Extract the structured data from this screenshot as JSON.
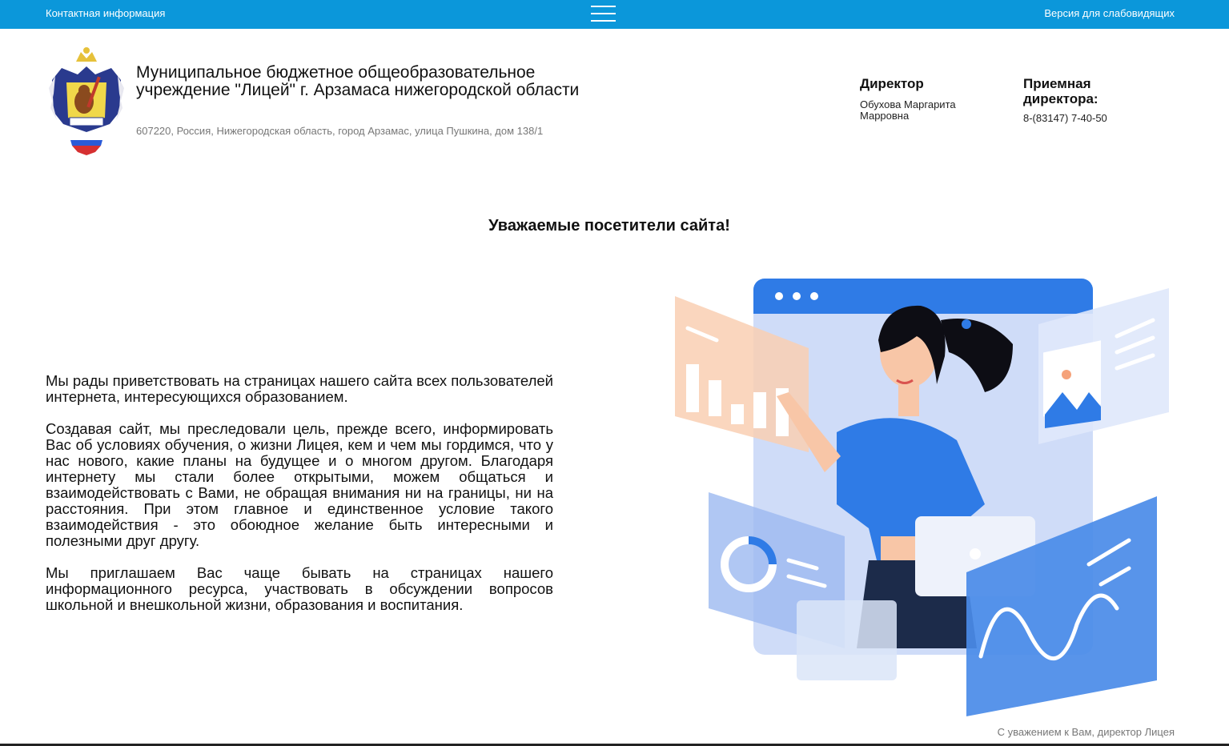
{
  "topbar": {
    "contact_link": "Контактная информация",
    "menu_icon": "hamburger-menu-icon",
    "accessibility_link": "Версия для слабовидящих",
    "background_color": "#0b97da"
  },
  "header": {
    "logo_icon": "school-emblem-logo",
    "org_name": "Муниципальное бюджетное общеобразовательное учреждение \"Лицей\" г. Арзамаса нижегородской области",
    "address": "607220, Россия, Нижегородская область, город Арзамас, улица Пушкина, дом 138/1",
    "director": {
      "title": "Директор",
      "name": "Обухова Маргарита Марровна"
    },
    "reception": {
      "title": "Приемная директора:",
      "phone": "8-(83147) 7-40-50"
    }
  },
  "main": {
    "greeting": "Уважаемые посетители сайта!",
    "paragraphs": [
      "Мы рады приветствовать на страницах нашего сайта всех пользователей интернета, интересующихся образованием.",
      "Создавая сайт, мы преследовали цель, прежде всего, информировать Вас об условиях обучения, о жизни Лицея, кем и чем мы гордимся, что у нас нового, какие планы на будущее и о многом другом. Благодаря интернету мы стали более открытыми, можем общаться и взаимодействовать с Вами, не обращая внимания ни на границы, ни на расстояния. При этом главное и единственное условие такого взаимодействия - это обоюдное желание быть интересными и полезными друг другу.",
      "Мы приглашаем Вас чаще бывать на страницах нашего информационного ресурса, участвовать в обсуждении вопросов школьной и внешкольной жизни, образования и воспитания."
    ],
    "illustration_icon": "woman-with-dashboards-illustration",
    "signature": "С уважением к Вам, директор Лицея"
  }
}
